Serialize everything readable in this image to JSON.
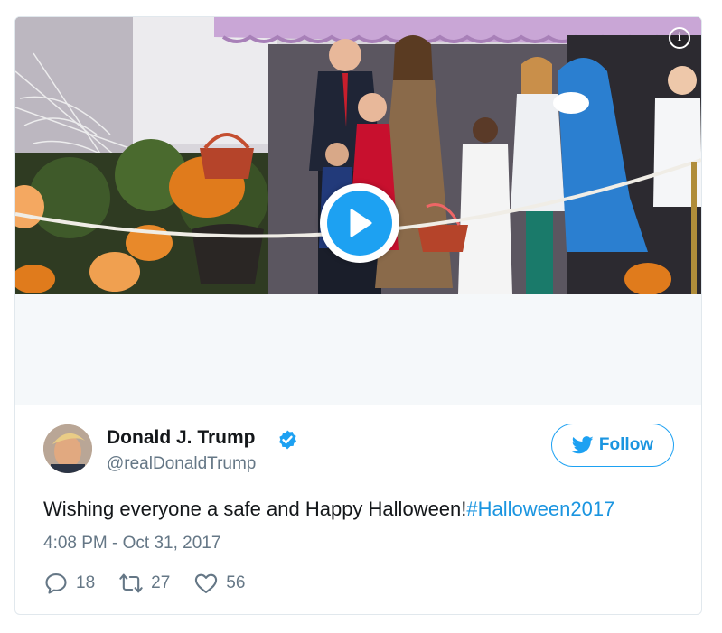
{
  "media": {
    "info_icon": "info-icon",
    "play_icon": "play-icon"
  },
  "tweet": {
    "display_name": "Donald J. Trump",
    "verified_icon": "verified-badge-icon",
    "handle": "@realDonaldTrump",
    "follow_label": "Follow",
    "text": "Wishing everyone a safe and Happy Halloween!",
    "hashtag": "#Halloween2017",
    "timestamp": "4:08 PM - Oct 31, 2017",
    "actions": {
      "reply_count": "18",
      "retweet_count": "27",
      "like_count": "56"
    }
  },
  "colors": {
    "brand_blue": "#1da1f2",
    "link_blue": "#1b95e0",
    "secondary_text": "#657786",
    "border": "#e1e8ed"
  }
}
